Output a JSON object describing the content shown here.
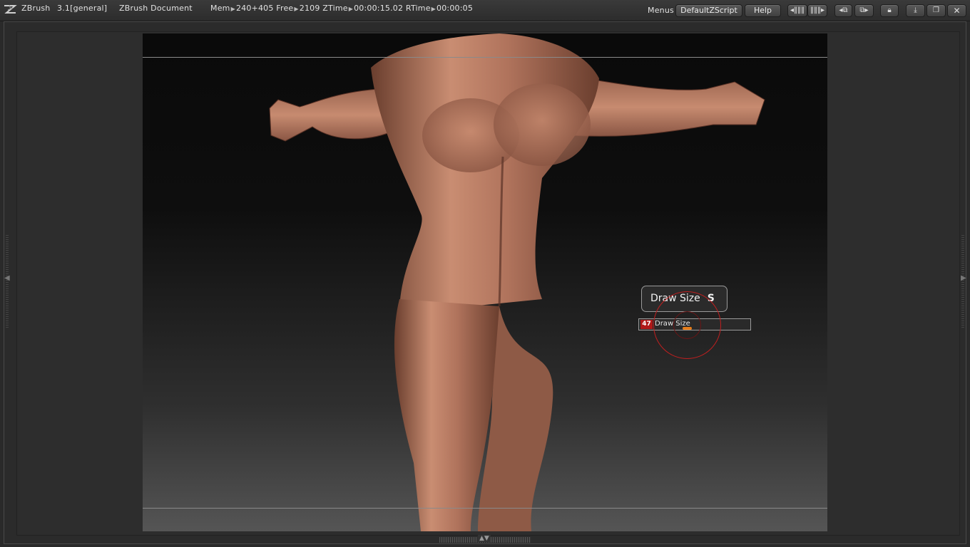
{
  "titlebar": {
    "app_name": "ZBrush",
    "version": "3.1[general]",
    "document": "ZBrush Document",
    "mem_label": "Mem",
    "mem_value": "240+405",
    "free_label": "Free",
    "free_value": "2109",
    "ztime_label": "ZTime",
    "ztime_value": "00:00:15.02",
    "rtime_label": "RTime",
    "rtime_value": "00:00:05",
    "menus_label": "Menus",
    "script_label": "DefaultZScript",
    "help_label": "Help"
  },
  "icons": {
    "logo": "zbrush-logo-icon",
    "palette_prev": "palette-arrows-icon",
    "palette_next": "palette-arrows-icon",
    "layout_1": "layout-icon",
    "layout_2": "layout-icon",
    "lock": "lock-icon",
    "minimize": "minimize-icon",
    "restore": "restore-icon",
    "close": "close-icon"
  },
  "canvas": {
    "subject": "3D human figure model (front view, T-pose)"
  },
  "popup": {
    "tooltip_title": "Draw Size",
    "tooltip_hotkey": "S",
    "slider_value": "47",
    "slider_label": "Draw Size"
  },
  "colors": {
    "brush_ring": "#c01f1f",
    "slider_value_bg": "#b01818",
    "slider_thumb": "#e67d1a",
    "canvas_top": "#0a0a0a",
    "canvas_bottom": "#555555"
  }
}
